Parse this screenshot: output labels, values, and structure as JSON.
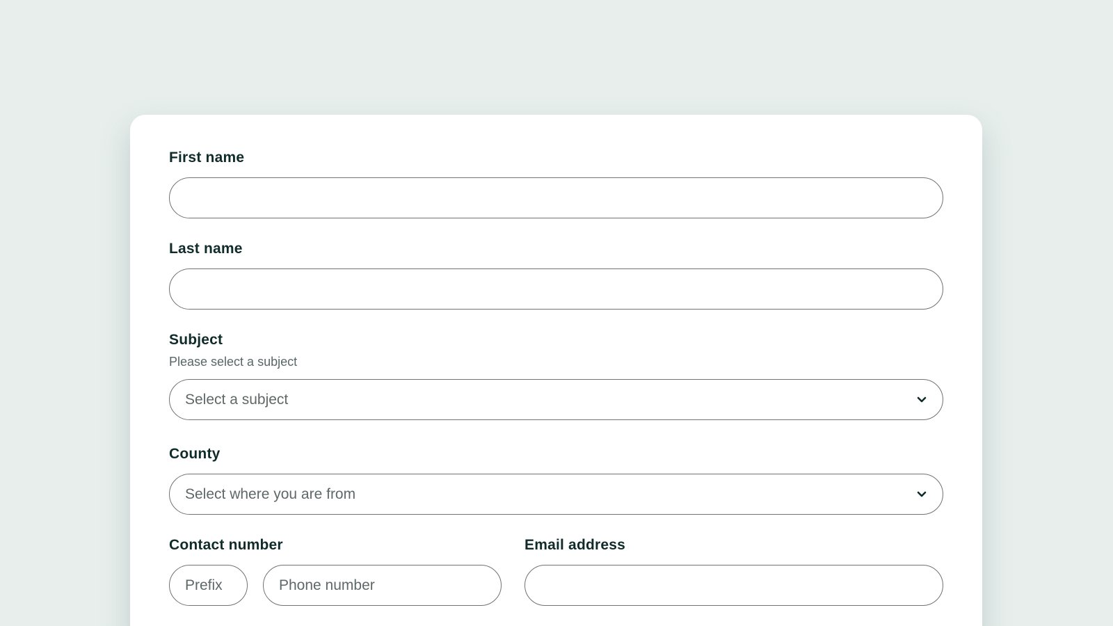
{
  "form": {
    "first_name": {
      "label": "First name",
      "value": ""
    },
    "last_name": {
      "label": "Last name",
      "value": ""
    },
    "subject": {
      "label": "Subject",
      "hint": "Please select a subject",
      "selected": "Select a subject"
    },
    "county": {
      "label": "County",
      "selected": "Select where you are from"
    },
    "contact_number": {
      "label": "Contact number",
      "prefix_placeholder": "Prefix",
      "phone_placeholder": "Phone number"
    },
    "email": {
      "label": "Email address",
      "value": ""
    }
  },
  "icons": {
    "dropdown": "chevron-down-icon"
  },
  "colors": {
    "background": "#e7eeec",
    "card": "#ffffff",
    "label_text": "#0f2b2a",
    "border": "#6e7272"
  }
}
